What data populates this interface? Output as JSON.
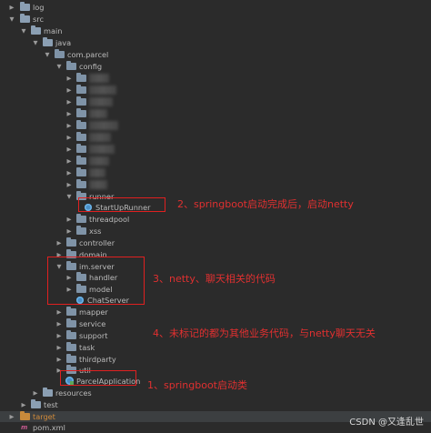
{
  "tree": {
    "log": "log",
    "src": "src",
    "main": "main",
    "java": "java",
    "com_parcel": "com.parcel",
    "config": "config",
    "runner": "runner",
    "startup_runner": "StartUpRunner",
    "threadpool": "threadpool",
    "xss": "xss",
    "controller": "controller",
    "domain": "domain",
    "im_server": "im.server",
    "handler": "handler",
    "model": "model",
    "chat_server": "ChatServer",
    "mapper": "mapper",
    "service": "service",
    "support": "support",
    "task": "task",
    "thirdparty": "thirdparty",
    "util": "util",
    "parcel_application": "ParcelApplication",
    "resources": "resources",
    "test": "test",
    "target": "target",
    "pom": "pom.xml"
  },
  "annotations": {
    "a1": "1、springboot启动类",
    "a2": "2、springboot启动完成后，启动netty",
    "a3": "3、netty、聊天相关的代码",
    "a4": "4、未标记的都为其他业务代码，与netty聊天无关"
  },
  "watermark": "CSDN @又逢乱世",
  "colors": {
    "background": "#2b2b2b",
    "text": "#bbbbbb",
    "highlight_box": "#e02020",
    "annotation": "#e03030",
    "target_folder": "#d08a3a"
  }
}
